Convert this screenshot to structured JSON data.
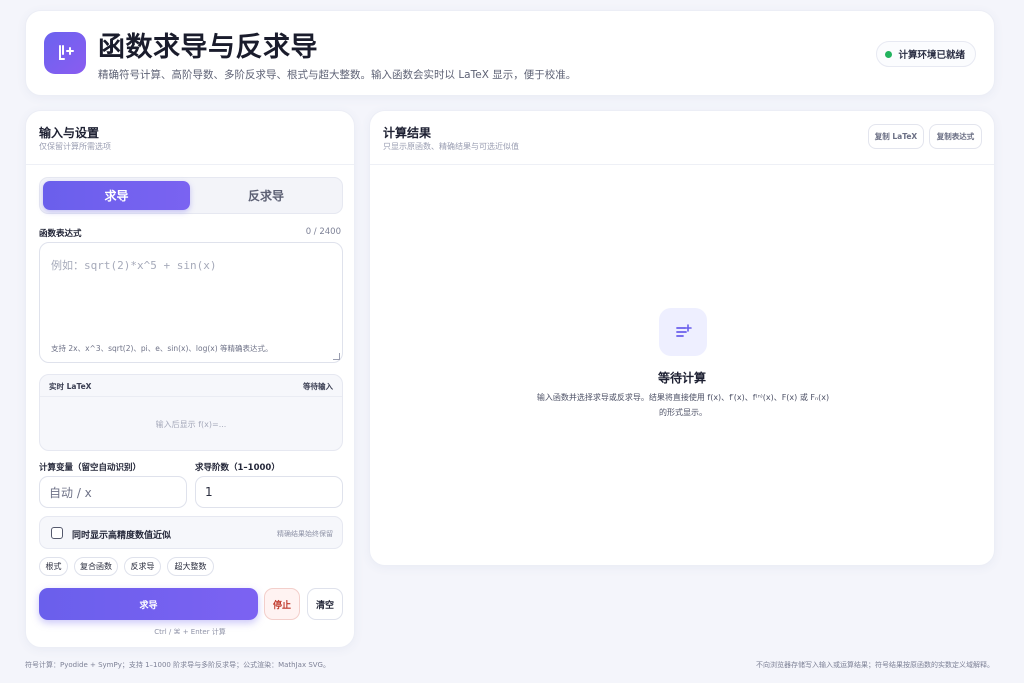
{
  "header": {
    "title": "函数求导与反求导",
    "subtitle": "精确符号计算、高阶导数、多阶反求导、根式与超大整数。输入函数会实时以 LaTeX 显示，便于校准。",
    "status": "计算环境已就绪",
    "logo_icon": "derivative-icon"
  },
  "left_panel": {
    "title": "输入与设置",
    "subtitle": "仅保留计算所需选项",
    "modes": [
      "求导",
      "反求导"
    ],
    "active_mode": "求导",
    "expression_label": "函数表达式",
    "char_count": "0 / 2400",
    "expression_placeholder": "例如：sqrt(2)*x^5 + sin(x)",
    "expression_hint": "支持 2x、x^3、sqrt(2)、pi、e、sin(x)、log(x) 等精确表达式。",
    "preview_title": "实时 LaTeX",
    "preview_status": "等待输入",
    "preview_empty": "输入后显示 f(x)=...",
    "variable_label": "计算变量（留空自动识别）",
    "variable_placeholder": "自动 / x",
    "order_label": "求导阶数（1–1000）",
    "order_value": "1",
    "approx_label": "同时显示高精度数值近似",
    "approx_note": "精确结果始终保留",
    "approx_checked": false,
    "chips": [
      "根式",
      "复合函数",
      "反求导",
      "超大整数"
    ],
    "compute_button": "求导",
    "stop_button": "停止",
    "clear_button": "清空",
    "shortcut": "Ctrl / ⌘ + Enter 计算"
  },
  "right_panel": {
    "title": "计算结果",
    "subtitle": "只显示原函数、精确结果与可选近似值",
    "copy_latex": "复制 LaTeX",
    "copy_expr": "复制表达式",
    "empty_title": "等待计算",
    "empty_text": "输入函数并选择求导或反求导。结果将直接使用 f(x)、f′(x)、f⁽ⁿ⁾(x)、F(x) 或 Fₙ(x) 的形式显示。"
  },
  "footer": {
    "left": "符号计算：Pyodide + SymPy；支持 1–1000 阶求导与多阶反求导；公式渲染：MathJax SVG。",
    "right": "不向浏览器存储写入输入或运算结果；符号结果按原函数的实数定义域解释。"
  },
  "colors": {
    "accent": "#6a5fec",
    "ready": "#22b35e",
    "stop": "#c0392b"
  }
}
